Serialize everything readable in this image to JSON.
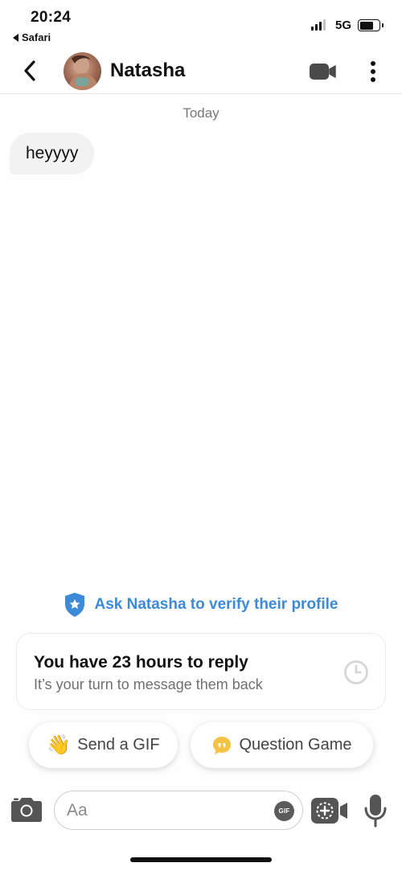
{
  "status_bar": {
    "time": "20:24",
    "back_app": "Safari",
    "network": "5G",
    "signal_bars_active": 3,
    "battery_level": 0.7
  },
  "header": {
    "contact_name": "Natasha",
    "icons": {
      "back": "chevron-left-icon",
      "video": "video-camera-icon",
      "more": "more-vertical-icon"
    }
  },
  "conversation": {
    "date_label": "Today",
    "messages": [
      {
        "text": "heyyyy",
        "sender": "contact"
      }
    ]
  },
  "verify_prompt": {
    "text": "Ask Natasha to verify their profile",
    "color": "#3c8ad8",
    "icon": "shield-star-icon"
  },
  "reply_card": {
    "title": "You have 23 hours to reply",
    "subtitle": "It’s your turn to message them back",
    "icon": "clock-icon"
  },
  "suggestions": {
    "gif_label": "Send a GIF",
    "gif_icon": "👋",
    "question_label": "Question Game",
    "question_icon": "speech-bubble-icon",
    "question_icon_color": "#f5c344"
  },
  "composer": {
    "placeholder": "Aa",
    "gif_badge": "GIF",
    "icons": {
      "camera": "camera-icon",
      "add_video": "add-video-icon",
      "mic": "microphone-icon"
    }
  }
}
